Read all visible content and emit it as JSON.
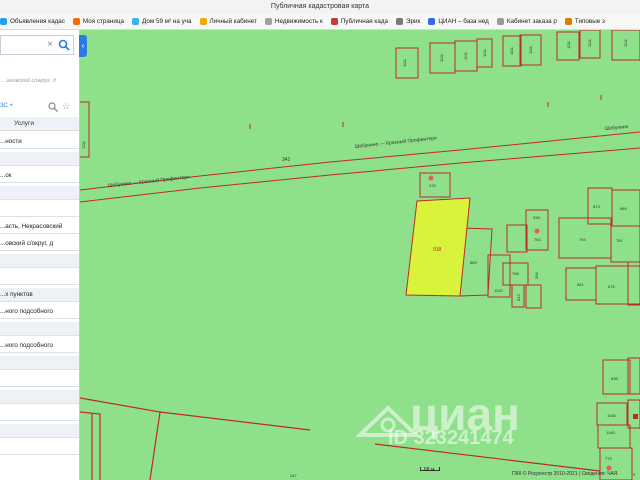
{
  "browser": {
    "title": "Публичная кадастровая карта",
    "bookmarks": [
      {
        "label": "Объявления кадас",
        "icon": "avito-icon",
        "color": "#1da1f2"
      },
      {
        "label": "Моя страница",
        "icon": "vk-icon",
        "color": "#ff6b00"
      },
      {
        "label": "Дом 59 м² на уча",
        "icon": "avito-icon",
        "color": "#3bb3f0"
      },
      {
        "label": "Личный кабинет",
        "icon": "ok-icon",
        "color": "#f2a900"
      },
      {
        "label": "Недвижимость к",
        "icon": "page-icon",
        "color": "#a0a0a0"
      },
      {
        "label": "Публичная када",
        "icon": "rosreestr-icon",
        "color": "#c23b3b"
      },
      {
        "label": "Эрик",
        "icon": "page-icon",
        "color": "#7a7a7a"
      },
      {
        "label": "ЦИАН – база нед",
        "icon": "cian-icon",
        "color": "#2d6ee8"
      },
      {
        "label": "Кабинет заказа р",
        "icon": "page-icon",
        "color": "#9a9a9a"
      },
      {
        "label": "Типовые з",
        "icon": "page-icon",
        "color": "#e07a00"
      }
    ]
  },
  "sidebar": {
    "search_value": "",
    "search_hint": "...ановский с/округ, д",
    "filter_link": "ЗС +",
    "tab_label": "Услуги",
    "rows": [
      {
        "text": "...ности",
        "alt": false
      },
      {
        "text": "",
        "alt": true
      },
      {
        "text": "...ок",
        "alt": false
      },
      {
        "text": "",
        "alt": true
      },
      {
        "text": "",
        "alt": false
      },
      {
        "text": "...асть, Некрасовский",
        "alt": false
      },
      {
        "text": "...овский с/округ, д",
        "alt": false
      },
      {
        "text": "",
        "alt": true
      },
      {
        "text": "",
        "alt": false
      },
      {
        "text": "...х пунктов",
        "alt": true
      },
      {
        "text": "...ного подсобного",
        "alt": false
      },
      {
        "text": "",
        "alt": true
      },
      {
        "text": "...ного подсобного",
        "alt": false
      },
      {
        "text": "",
        "alt": true
      },
      {
        "text": "",
        "alt": false
      },
      {
        "text": "",
        "alt": true
      },
      {
        "text": "",
        "alt": false
      },
      {
        "text": "",
        "alt": true
      },
      {
        "text": "",
        "alt": false
      }
    ]
  },
  "map": {
    "road_label_1": "Шебунино — Красный Профинтерн",
    "road_label_2": "Шебунино — Красный Профинтерн",
    "road_label_3": "Шебунино",
    "road_parcel": "341",
    "parcel_labels": {
      "p1": "1111",
      "p2": "1111",
      "p3": "1111",
      "p4": "1111",
      "p5": "1111",
      "p6": "1111",
      "p7": "1111",
      "p8": "1111",
      "p9": "1111",
      "p10": "1111",
      "p11": "376",
      "p12": "338",
      "p13": "763",
      "p14": "889",
      "p15": "1133",
      "p16": "766",
      "p17": "396",
      "p18": "813",
      "p19": "794",
      "p20": "751",
      "p21": "873",
      "p22": "889",
      "p23": "881",
      "p24": "876",
      "p25": "636",
      "p26": "1148",
      "p27": "1145",
      "p28": "775",
      "p29": "247",
      "p30": "9"
    },
    "selected_parcel": "918",
    "scale_label": "68 м",
    "attribution": "ПКК © Росреестр 2010-2021 | Сведения: ЧАЯ",
    "watermark_brand": "циан",
    "watermark_id": "ID 323241474",
    "colors": {
      "background": "#8ee08a",
      "parcel_border": "#c0292b",
      "selected_fill": "#d9f23a"
    }
  }
}
